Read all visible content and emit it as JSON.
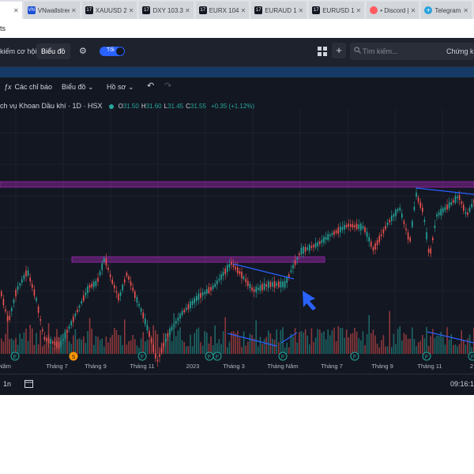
{
  "browser": {
    "first_tab_label": "",
    "tabs": [
      {
        "title": "VNwallstree",
        "icon": "vnwallstreet-icon",
        "kind": "vn"
      },
      {
        "title": "XAUUSD 2",
        "icon": "tradingview-icon",
        "kind": "tv"
      },
      {
        "title": "DXY 103.3",
        "icon": "tradingview-icon",
        "kind": "tv"
      },
      {
        "title": "EURX 104",
        "icon": "tradingview-icon",
        "kind": "tv"
      },
      {
        "title": "EURAUD 1",
        "icon": "tradingview-icon",
        "kind": "tv"
      },
      {
        "title": "EURUSD 1",
        "icon": "tradingview-icon",
        "kind": "tv"
      },
      {
        "title": "• Discord |",
        "icon": "discord-icon",
        "kind": "discord"
      },
      {
        "title": "Telegram",
        "icon": "telegram-icon",
        "kind": "telegram"
      }
    ],
    "url_fragment": "ts"
  },
  "header": {
    "left_link": "kiếm cơ hội",
    "chart_button": "Biểu đồ",
    "toggle_label": "Tối",
    "search_placeholder": "Tìm kiếm...",
    "stock_link": "Chứng k"
  },
  "toolbar": {
    "indicators": "Các chỉ báo",
    "chart_menu": "Biểu đồ",
    "profile_menu": "Hồ sơ"
  },
  "symbol": {
    "name": "ch vụ Khoan Dầu khí · 1D · HSX",
    "ohlc": [
      {
        "k": "O",
        "v": "31.50"
      },
      {
        "k": "H",
        "v": "31.60"
      },
      {
        "k": "L",
        "v": "31.45"
      },
      {
        "k": "C",
        "v": "31.55"
      }
    ],
    "change": "+0.35 (+1.12%)"
  },
  "colors": {
    "up": "#26a69a",
    "down": "#ef5350",
    "zone": "#9c27b0",
    "trendline": "#2962ff",
    "background": "#131722",
    "grid": "#1e222d"
  },
  "chart_data": {
    "type": "candlestick",
    "x_axis_labels": [
      "Năm",
      "Tháng 7",
      "Tháng 9",
      "Tháng 11",
      "2023",
      "Tháng 3",
      "Tháng Năm",
      "Tháng 7",
      "Tháng 9",
      "Tháng 11",
      "2"
    ],
    "event_markers": [
      "E",
      "S",
      "F",
      "F",
      "F",
      "F",
      "F",
      "F",
      "F"
    ],
    "grid": true,
    "volume_pane": true
  },
  "bottombar": {
    "range": "1n",
    "clock": "09:16:1"
  }
}
